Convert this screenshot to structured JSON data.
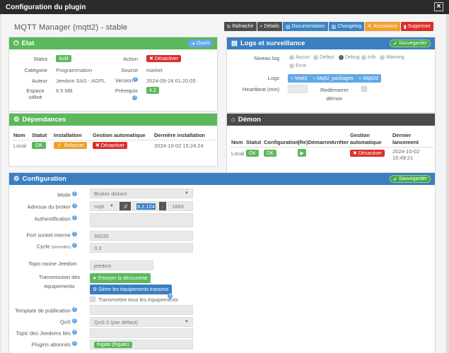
{
  "window": {
    "title": "Configuration du plugin",
    "close": "×"
  },
  "plugin": {
    "title": "MQTT Manager (mqtt2) - stable"
  },
  "toolbar": {
    "refresh": "Rafraichir",
    "details": "Détails",
    "documentation": "Documentation",
    "changelog": "Changelog",
    "assistance": "Assistance",
    "delete": "Supprimer"
  },
  "etat": {
    "title": "Etat",
    "open_btn": "Ouvrir",
    "statut_label": "Statut",
    "statut_value": "Actif",
    "action_label": "Action",
    "action_value": "Désactiver",
    "categorie_label": "Catégorie",
    "categorie_value": "Programmation",
    "source_label": "Source",
    "source_value": "market",
    "auteur_label": "Auteur",
    "auteur_value": "Jeedom SAS - AGPL",
    "version_label": "Version",
    "version_value": "2024-09-24 01:20:05",
    "espace_label": "Espace utilisé",
    "espace_value": "8.5 MB",
    "prerequis_label": "Prérequis",
    "prerequis_value": "4.2"
  },
  "logs": {
    "title": "Logs et surveillance",
    "save_btn": "Sauvegarder",
    "niveau_label": "Niveau log",
    "levels": [
      "Aucun",
      "Defaut",
      "Debug",
      "Info",
      "Warning",
      "Error"
    ],
    "selected_level": "Debug",
    "logs_label": "Logs",
    "log_files": [
      "Mqtt2",
      "Mqtt2_packages",
      "Mqtt2d"
    ],
    "heartbeat_label": "Heartbeat (min)",
    "heartbeat_value": "",
    "redemarrer_label": "Redémarrer démon"
  },
  "dependances": {
    "title": "Dépendances",
    "headers": [
      "Nom",
      "Statut",
      "Installation",
      "Gestion automatique",
      "Dernière installation"
    ],
    "row": {
      "nom": "Local",
      "statut": "OK",
      "installation": "Relancer",
      "gestion": "Désactiver",
      "derniere": "2024-10-02 15:24:24"
    }
  },
  "demon": {
    "title": "Démon",
    "headers": [
      "Nom",
      "Statut",
      "Configuration",
      "(Re)Démarrer",
      "Arrêter",
      "Gestion automatique",
      "Dernier lancement"
    ],
    "row": {
      "nom": "Local",
      "statut": "OK",
      "configuration": "OK",
      "gestion": "Désactiver",
      "dernier": "2024-10-02 15:49:21"
    }
  },
  "configuration": {
    "title": "Configuration",
    "save_btn": "Sauvegarder",
    "mode_label": "Mode",
    "mode_value": "Broker distant",
    "broker_label": "Adresse du broker",
    "broker_protocol": "mqtt",
    "broker_sep": "://",
    "broker_host": "8.2.124",
    "broker_colon": ":",
    "broker_port": "1883",
    "auth_label": "Authentification",
    "port_socket_label": "Port socket interne",
    "port_socket_value": "55035",
    "cycle_label": "Cycle",
    "cycle_unit": "(secondes)",
    "cycle_value": "0.3",
    "topic_racine_label": "Topic racine Jeedom",
    "topic_racine_value": "jeedom",
    "transmission_label": "Transmission des équipements",
    "send_discovery_btn": "Envoyer la découverte",
    "manage_equipment_btn": "Gérer les équipements transmis",
    "transmit_all_label": "Transmettre tous les équipements",
    "template_label": "Template de publication",
    "qos_label": "QoS",
    "qos_value": "QoS 0 (par défaut)",
    "topic_jeedoms_label": "Topic des Jeedoms liés",
    "plugins_label": "Plugins abonnés",
    "plugins_value": "frigate (frigate)"
  }
}
